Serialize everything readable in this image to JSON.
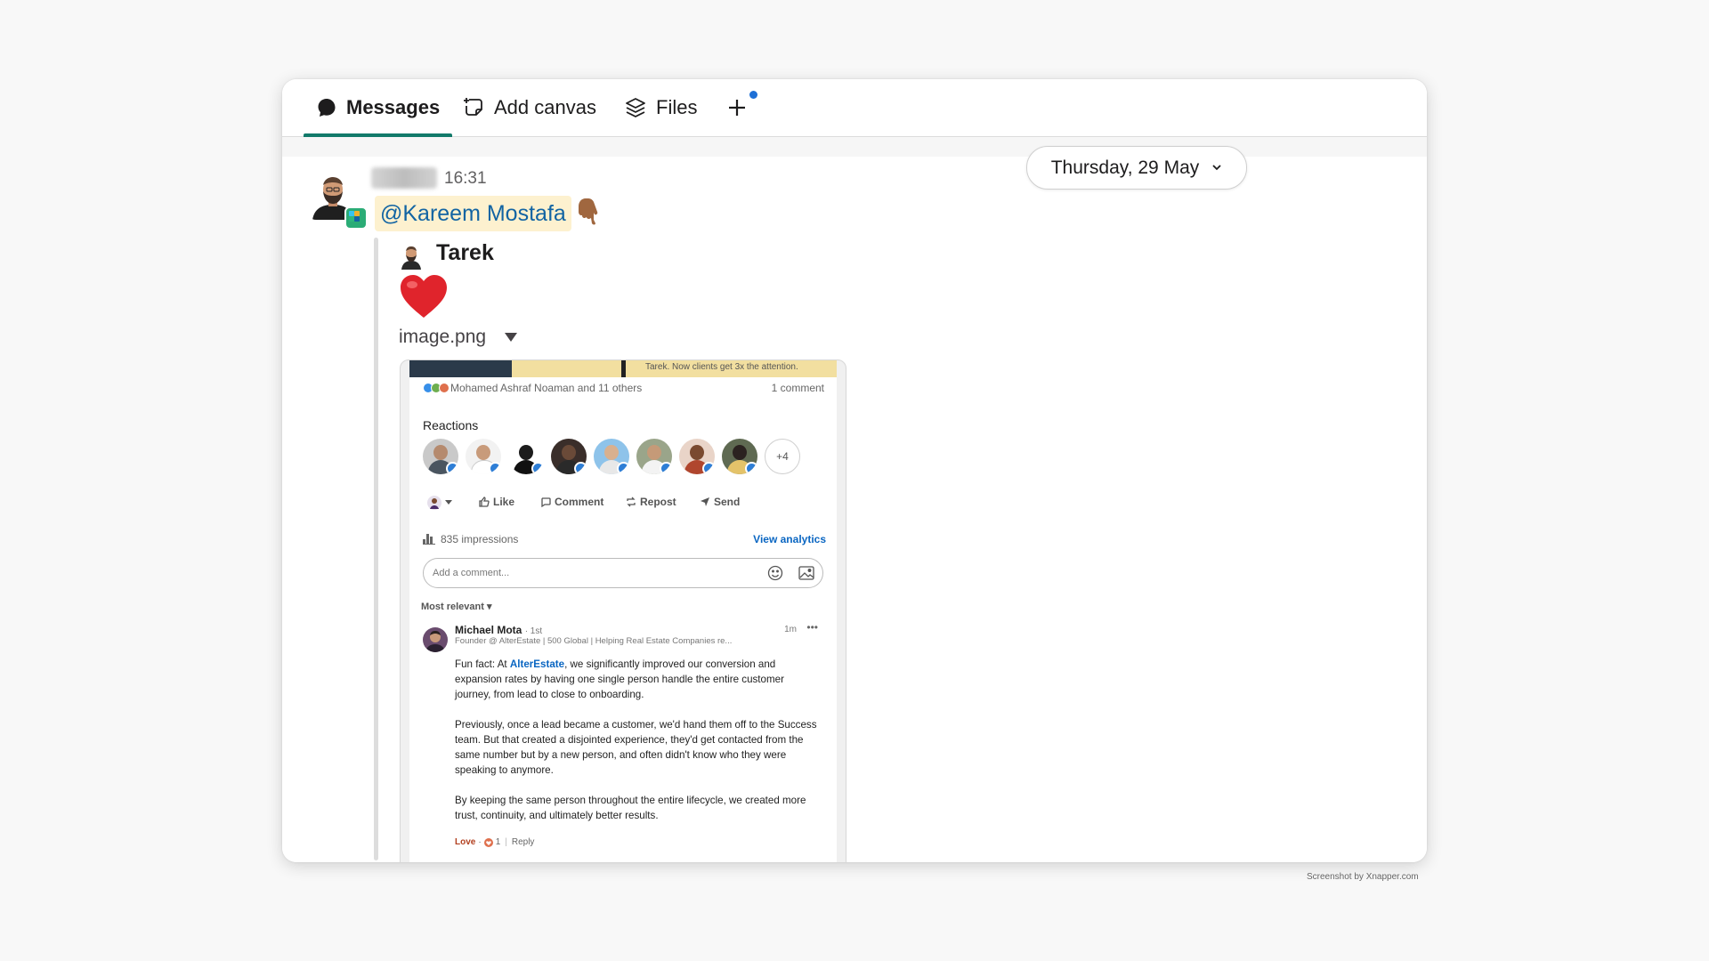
{
  "tabs": {
    "messages": "Messages",
    "add_canvas": "Add canvas",
    "files": "Files"
  },
  "date_pill": {
    "label": "Thursday, 29 May"
  },
  "message": {
    "time": "16:31",
    "mention": "@Kareem Mostafa",
    "quoted": {
      "author": "Tarek",
      "file_name": "image.png"
    }
  },
  "post": {
    "banner_text": "Tarek. Now clients get 3x the attention.",
    "reactors_text": "Mohamed Ashraf Noaman and 11 others",
    "comments_count": "1 comment",
    "reactions_title": "Reactions",
    "more_reactors": "+4",
    "actions": {
      "like": "Like",
      "comment": "Comment",
      "repost": "Repost",
      "send": "Send"
    },
    "impressions": "835 impressions",
    "view_analytics": "View analytics",
    "comment_placeholder": "Add a comment...",
    "sort_label": "Most relevant ▾",
    "comment": {
      "author": "Michael Mota",
      "degree": "· 1st",
      "headline": "Founder @ AlterEstate | 500 Global | Helping Real Estate Companies re...",
      "time": "1m",
      "p1_before": "Fun fact: At ",
      "p1_link": "AlterEstate",
      "p1_after": ", we significantly improved our conversion and expansion rates by having one single person handle the entire customer journey, from lead to close to onboarding.",
      "p2": "Previously, once a lead became a customer, we'd hand them off to the Success team. But that created a disjointed experience, they'd get contacted from the same number but by a new person, and often didn't know who they were speaking to anymore.",
      "p3": "By keeping the same person throughout the entire lifecycle, we created more trust, continuity, and ultimately better results.",
      "love": "Love",
      "love_count": "1",
      "reply": "Reply"
    }
  },
  "watermark": "Screenshot by Xnapper.com",
  "colors": {
    "accent_tab": "#127a6a",
    "mention_bg": "#fdf1cf",
    "mention_text": "#1264a3",
    "linkedin_blue": "#0a66c2"
  },
  "icons": [
    "messages-icon",
    "add-canvas-icon",
    "files-icon",
    "plus-icon",
    "chevron-down-icon",
    "point-down-emoji",
    "heart-emoji",
    "caret-down-icon"
  ]
}
